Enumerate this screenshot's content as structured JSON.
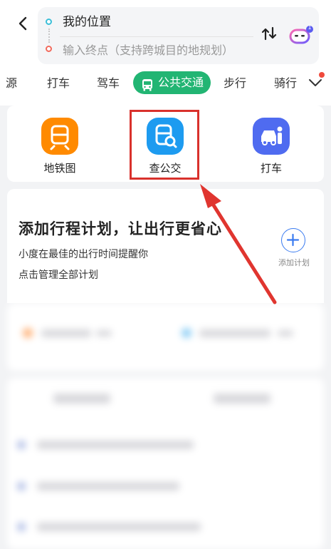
{
  "route": {
    "start": "我的位置",
    "end_placeholder": "输入终点（支持跨城目的地规划）"
  },
  "tabs": [
    {
      "label": "源"
    },
    {
      "label": "打车"
    },
    {
      "label": "驾车"
    },
    {
      "label": "公共交通",
      "active": true
    },
    {
      "label": "步行"
    },
    {
      "label": "骑行"
    }
  ],
  "assistant_badge": "1",
  "shortcuts": [
    {
      "label": "地铁图",
      "icon": "subway-icon",
      "color": "#ff8a00"
    },
    {
      "label": "查公交",
      "icon": "bus-search-icon",
      "color": "#1d9bf0"
    },
    {
      "label": "打车",
      "icon": "taxi-icon",
      "color": "#4f6bf0"
    }
  ],
  "plan": {
    "title": "添加行程计划，让出行更省心",
    "subtitle1": "小度在最佳的出行时间提醒你",
    "subtitle2": "点击管理全部计划",
    "add_label": "添加计划"
  },
  "colors": {
    "accent_green": "#22b573",
    "highlight_red": "#d9312c",
    "arrow_red": "#e0352f"
  }
}
